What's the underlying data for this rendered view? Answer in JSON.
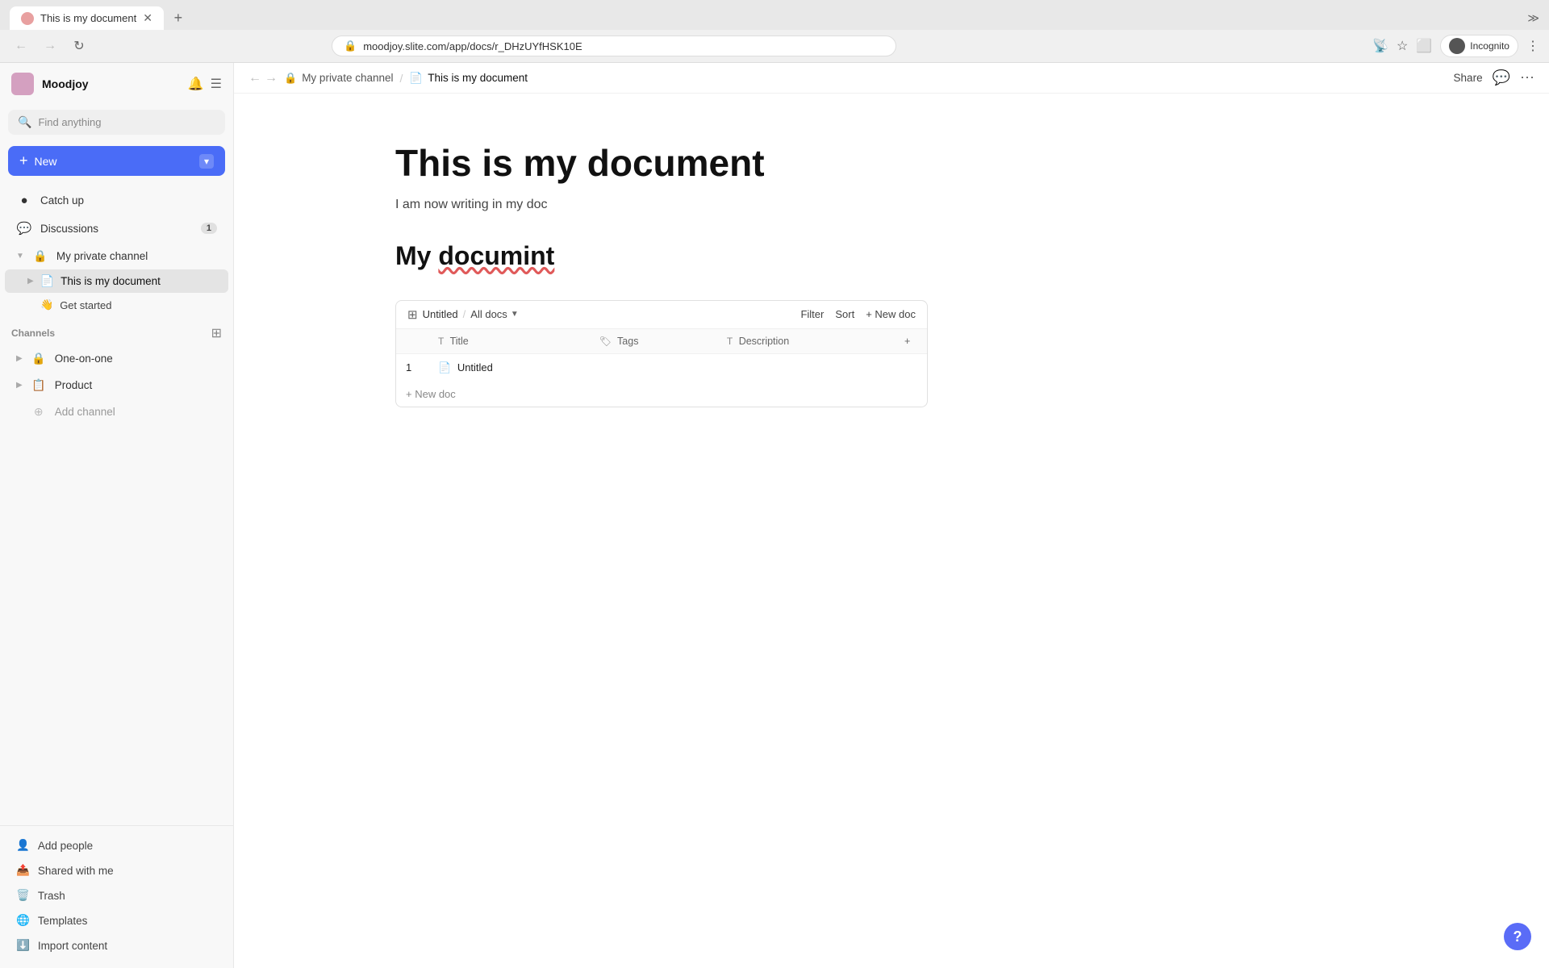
{
  "browser": {
    "tab_title": "This is my document",
    "url": "moodjoy.slite.com/app/docs/r_DHzUYfHSK10E",
    "nav_back_label": "←",
    "nav_forward_label": "→",
    "nav_refresh_label": "↻",
    "incognito_label": "Incognito",
    "tab_new_label": "+",
    "tab_expand_label": "≫"
  },
  "sidebar": {
    "workspace_name": "Moodjoy",
    "search_placeholder": "Find anything",
    "new_button_label": "New",
    "nav_items": [
      {
        "id": "catch-up",
        "label": "Catch up",
        "icon": "●"
      },
      {
        "id": "discussions",
        "label": "Discussions",
        "icon": "💬",
        "badge": "1"
      }
    ],
    "private_channel": {
      "label": "My private channel",
      "icon": "🔒",
      "docs": [
        {
          "id": "my-doc",
          "label": "This is my document",
          "icon": "📄"
        }
      ],
      "sub_items": [
        {
          "id": "get-started",
          "label": "Get started",
          "icon": "👋"
        }
      ]
    },
    "channels_section_label": "Channels",
    "channels": [
      {
        "id": "one-on-one",
        "label": "One-on-one",
        "icon": "🔒"
      },
      {
        "id": "product",
        "label": "Product",
        "icon": "📋"
      }
    ],
    "add_channel_label": "Add channel",
    "bottom_items": [
      {
        "id": "add-people",
        "label": "Add people",
        "icon": "👤"
      },
      {
        "id": "shared-with-me",
        "label": "Shared with me",
        "icon": "📤"
      },
      {
        "id": "trash",
        "label": "Trash",
        "icon": "🗑️"
      },
      {
        "id": "templates",
        "label": "Templates",
        "icon": "🌐"
      },
      {
        "id": "import-content",
        "label": "Import content",
        "icon": "⬇️"
      }
    ]
  },
  "topbar": {
    "breadcrumb_channel": "My private channel",
    "breadcrumb_doc": "This is my document",
    "share_label": "Share"
  },
  "document": {
    "title": "This is my document",
    "subtitle": "I am now writing in my doc",
    "heading": "My documint",
    "heading_squiggly_word": "documint",
    "widget": {
      "db_label": "Untitled",
      "alldocs_label": "All docs",
      "filter_label": "Filter",
      "sort_label": "Sort",
      "new_doc_label": "+ New doc",
      "columns": [
        {
          "id": "title",
          "label": "Title",
          "icon": "T"
        },
        {
          "id": "tags",
          "label": "Tags",
          "icon": "🏷"
        },
        {
          "id": "description",
          "label": "Description",
          "icon": "T"
        }
      ],
      "rows": [
        {
          "num": "1",
          "title": "Untitled",
          "tags": "",
          "description": ""
        }
      ],
      "footer_label": "+ New doc"
    }
  }
}
